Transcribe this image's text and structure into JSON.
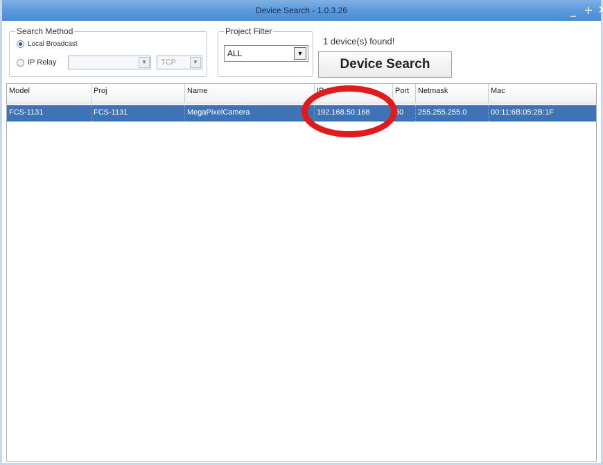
{
  "window": {
    "title": "Device Search - 1.0.3.26",
    "minimize_glyph": "_",
    "maximize_glyph": "+",
    "close_glyph": "✕"
  },
  "search_method": {
    "legend": "Search Method",
    "local_broadcast_label": "Local Broadcast",
    "local_broadcast_checked": true,
    "ip_relay_label": "IP Relay",
    "ip_relay_checked": false,
    "ip_relay_value": "",
    "protocol_value": "TCP"
  },
  "project_filter": {
    "legend": "Project Filter",
    "selected": "ALL"
  },
  "status": {
    "found_text": "1 device(s) found!"
  },
  "toolbar": {
    "search_label": "Device Search"
  },
  "table": {
    "columns": [
      "Model",
      "Proj",
      "Name",
      "IP",
      "Port",
      "Netmask",
      "Mac"
    ],
    "rows": [
      {
        "model": "FCS-1131",
        "proj": "FCS-1131",
        "name": "MegaPixelCamera",
        "ip": "192.168.50.168",
        "port": "80",
        "netmask": "255.255.255.0",
        "mac": "00:11:6B:05:2B:1F",
        "selected": true
      }
    ]
  },
  "annotation": {
    "highlight_color": "#e11b1b"
  }
}
